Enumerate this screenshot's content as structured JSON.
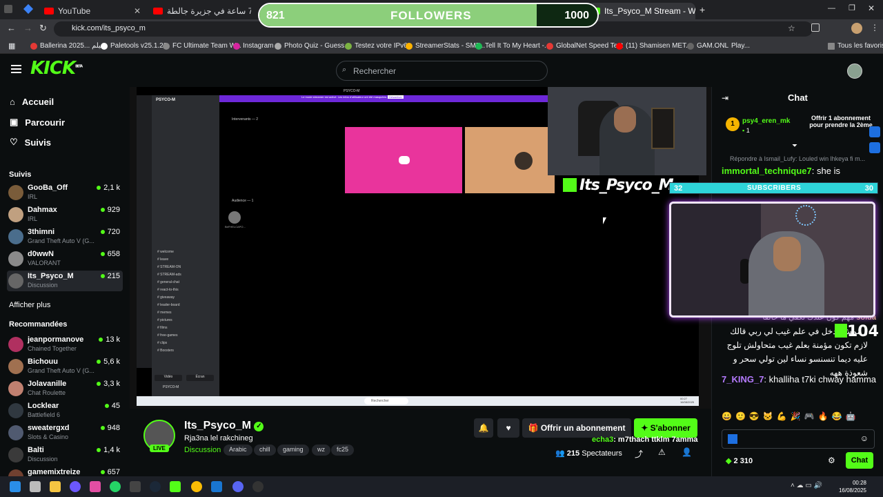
{
  "browser": {
    "tabs": [
      {
        "label": "YouTube",
        "color": "#ff0000"
      },
      {
        "label": "تحدي 72 ساعة في جزيرة جالطة",
        "color": "#ff0000"
      },
      {
        "label": "Its_Psyco_M Stream - Watc",
        "color": "#53fc18"
      }
    ],
    "url": "kick.com/its_psyco_m",
    "bookmarks": [
      "Ballerina 2025... فيلم",
      "Paletools v25.1.23",
      "FC Ultimate Team W...",
      "Instagram",
      "Photo Quiz - Guess...",
      "Testez votre IPv6.",
      "StreamerStats - SMF...",
      "Tell It To My Heart -...",
      "GlobalNet Speed Test",
      "(11) Shamisen MET...",
      "GAM.ONL",
      "Play...",
      "Tous les favoris"
    ]
  },
  "kick": {
    "logo": "KICK",
    "logo_badge": "BETA",
    "search_placeholder": "Rechercher"
  },
  "sidebar": {
    "nav": [
      {
        "label": "Accueil",
        "icon": "home-icon"
      },
      {
        "label": "Parcourir",
        "icon": "browse-icon"
      },
      {
        "label": "Suivis",
        "icon": "heart-icon"
      }
    ],
    "following_header": "Suivis",
    "following": [
      {
        "name": "GooBa_Off",
        "category": "IRL",
        "viewers": "2,1 k",
        "color": "#7a5c3a"
      },
      {
        "name": "Dahmax",
        "category": "IRL",
        "viewers": "929",
        "color": "#c0a080"
      },
      {
        "name": "3thimni",
        "category": "Grand Theft Auto V (G...",
        "viewers": "720",
        "color": "#4a6d8c"
      },
      {
        "name": "d0wwN",
        "category": "VALORANT",
        "viewers": "658",
        "color": "#8a8a8a"
      },
      {
        "name": "Its_Psyco_M",
        "category": "Discussion",
        "viewers": "215",
        "color": "#666"
      }
    ],
    "show_more": "Afficher plus",
    "recommended_header": "Recommandées",
    "recommended": [
      {
        "name": "jeanpormanove",
        "category": "Chained Together",
        "viewers": "13 k",
        "color": "#b03060"
      },
      {
        "name": "Bichouu",
        "category": "Grand Theft Auto V (G...",
        "viewers": "5,6 k",
        "color": "#a07050"
      },
      {
        "name": "Jolavanille",
        "category": "Chat Roulette",
        "viewers": "3,3 k",
        "color": "#c08070"
      },
      {
        "name": "Locklear",
        "category": "Battlefield 6",
        "viewers": "45",
        "color": "#303840"
      },
      {
        "name": "sweatergxd",
        "category": "Slots & Casino",
        "viewers": "948",
        "color": "#505a70"
      },
      {
        "name": "Balti",
        "category": "Discussion",
        "viewers": "1,4 k",
        "color": "#3a3a3a"
      },
      {
        "name": "gamemixtreize",
        "category": "",
        "viewers": "657",
        "color": "#704030"
      }
    ]
  },
  "overlays": {
    "followers": {
      "count": "821",
      "label": "FOLLOWERS",
      "goal": "1000",
      "progress": 0.821
    },
    "subscribers": {
      "count": "32",
      "label": "SUBSCRIBERS",
      "goal": "30",
      "progress": 1.0
    },
    "streamer_tag": "Its_Psyco_M",
    "discord_header": "PSYCO-M",
    "discord_banner": "Le mode streamer est activé. Les infos d'utilisateur ont été masquées.",
    "discord_banner_btn": "Désactiver",
    "discord_voice_header": "Intervenants — 2",
    "discord_audience": "Audience — 1",
    "discord_audience_name": "BeFHELCAPO...",
    "discord_channels": [
      "# welcome",
      "# leave",
      "# STREAM-ON",
      "# STREAM-ads",
      "# general-chat",
      "# react-to-this",
      "# giveaway",
      "# leader-board",
      "# memes",
      "# pictures",
      "# films",
      "# free-games",
      "# clips",
      "# Boosters"
    ],
    "discord_user": "PSYCO-M",
    "discord_video_btn": "Vidéo",
    "discord_screen_btn": "Écran",
    "windows_search": "Rechercher",
    "win_clock_time": "00:27",
    "win_clock_date": "16/08/2025"
  },
  "chat": {
    "title": "Chat",
    "gift_user": "psy4_eren_mk",
    "gift_rank": "1",
    "gift_count": "1",
    "gift_text": "Offrir 1 abonnement pour prendre la 2ème",
    "reply_hint": "Répondre à Ismail_Lufy: Louled win lhkeya fi m...",
    "messages": [
      {
        "user": "immortal_technique7",
        "color": "#53fc18",
        "text": "she is"
      },
      {
        "user": "solda",
        "color": "#e5c07b",
        "text": "مهم كون عندك تكفي ما خالقا"
      },
      {
        "user": "",
        "color": "#fff",
        "text": "و ممش يدخل في علم غيب لي ربي قالك لازم تكون مؤمنة بعلم غيب متحاولش تلوج عليه ديما تنسنسو نساء لين تولي سحر و شعوذة ههه"
      },
      {
        "user": "7_KING_7",
        "color": "#b57bff",
        "text": "khalliha t7ki chway hamma"
      }
    ],
    "kick_count": "104",
    "points": "2 310",
    "send_label": "Chat"
  },
  "stream": {
    "name": "Its_Psyco_M",
    "title": "Rja3na lel rakchineg",
    "category": "Discussion",
    "tags": [
      "Arabic",
      "chill",
      "gaming",
      "wz",
      "fc25"
    ],
    "live": "LIVE",
    "gift_btn": "Offrir un abonnement",
    "sub_btn": "S'abonner",
    "viewers": "215",
    "viewers_label": "Spectateurs",
    "ticker_user": "echa3",
    "ticker_text": ": m7thach ttklm 7amma"
  },
  "taskbar": {
    "time": "00:28",
    "date": "16/08/2025"
  }
}
